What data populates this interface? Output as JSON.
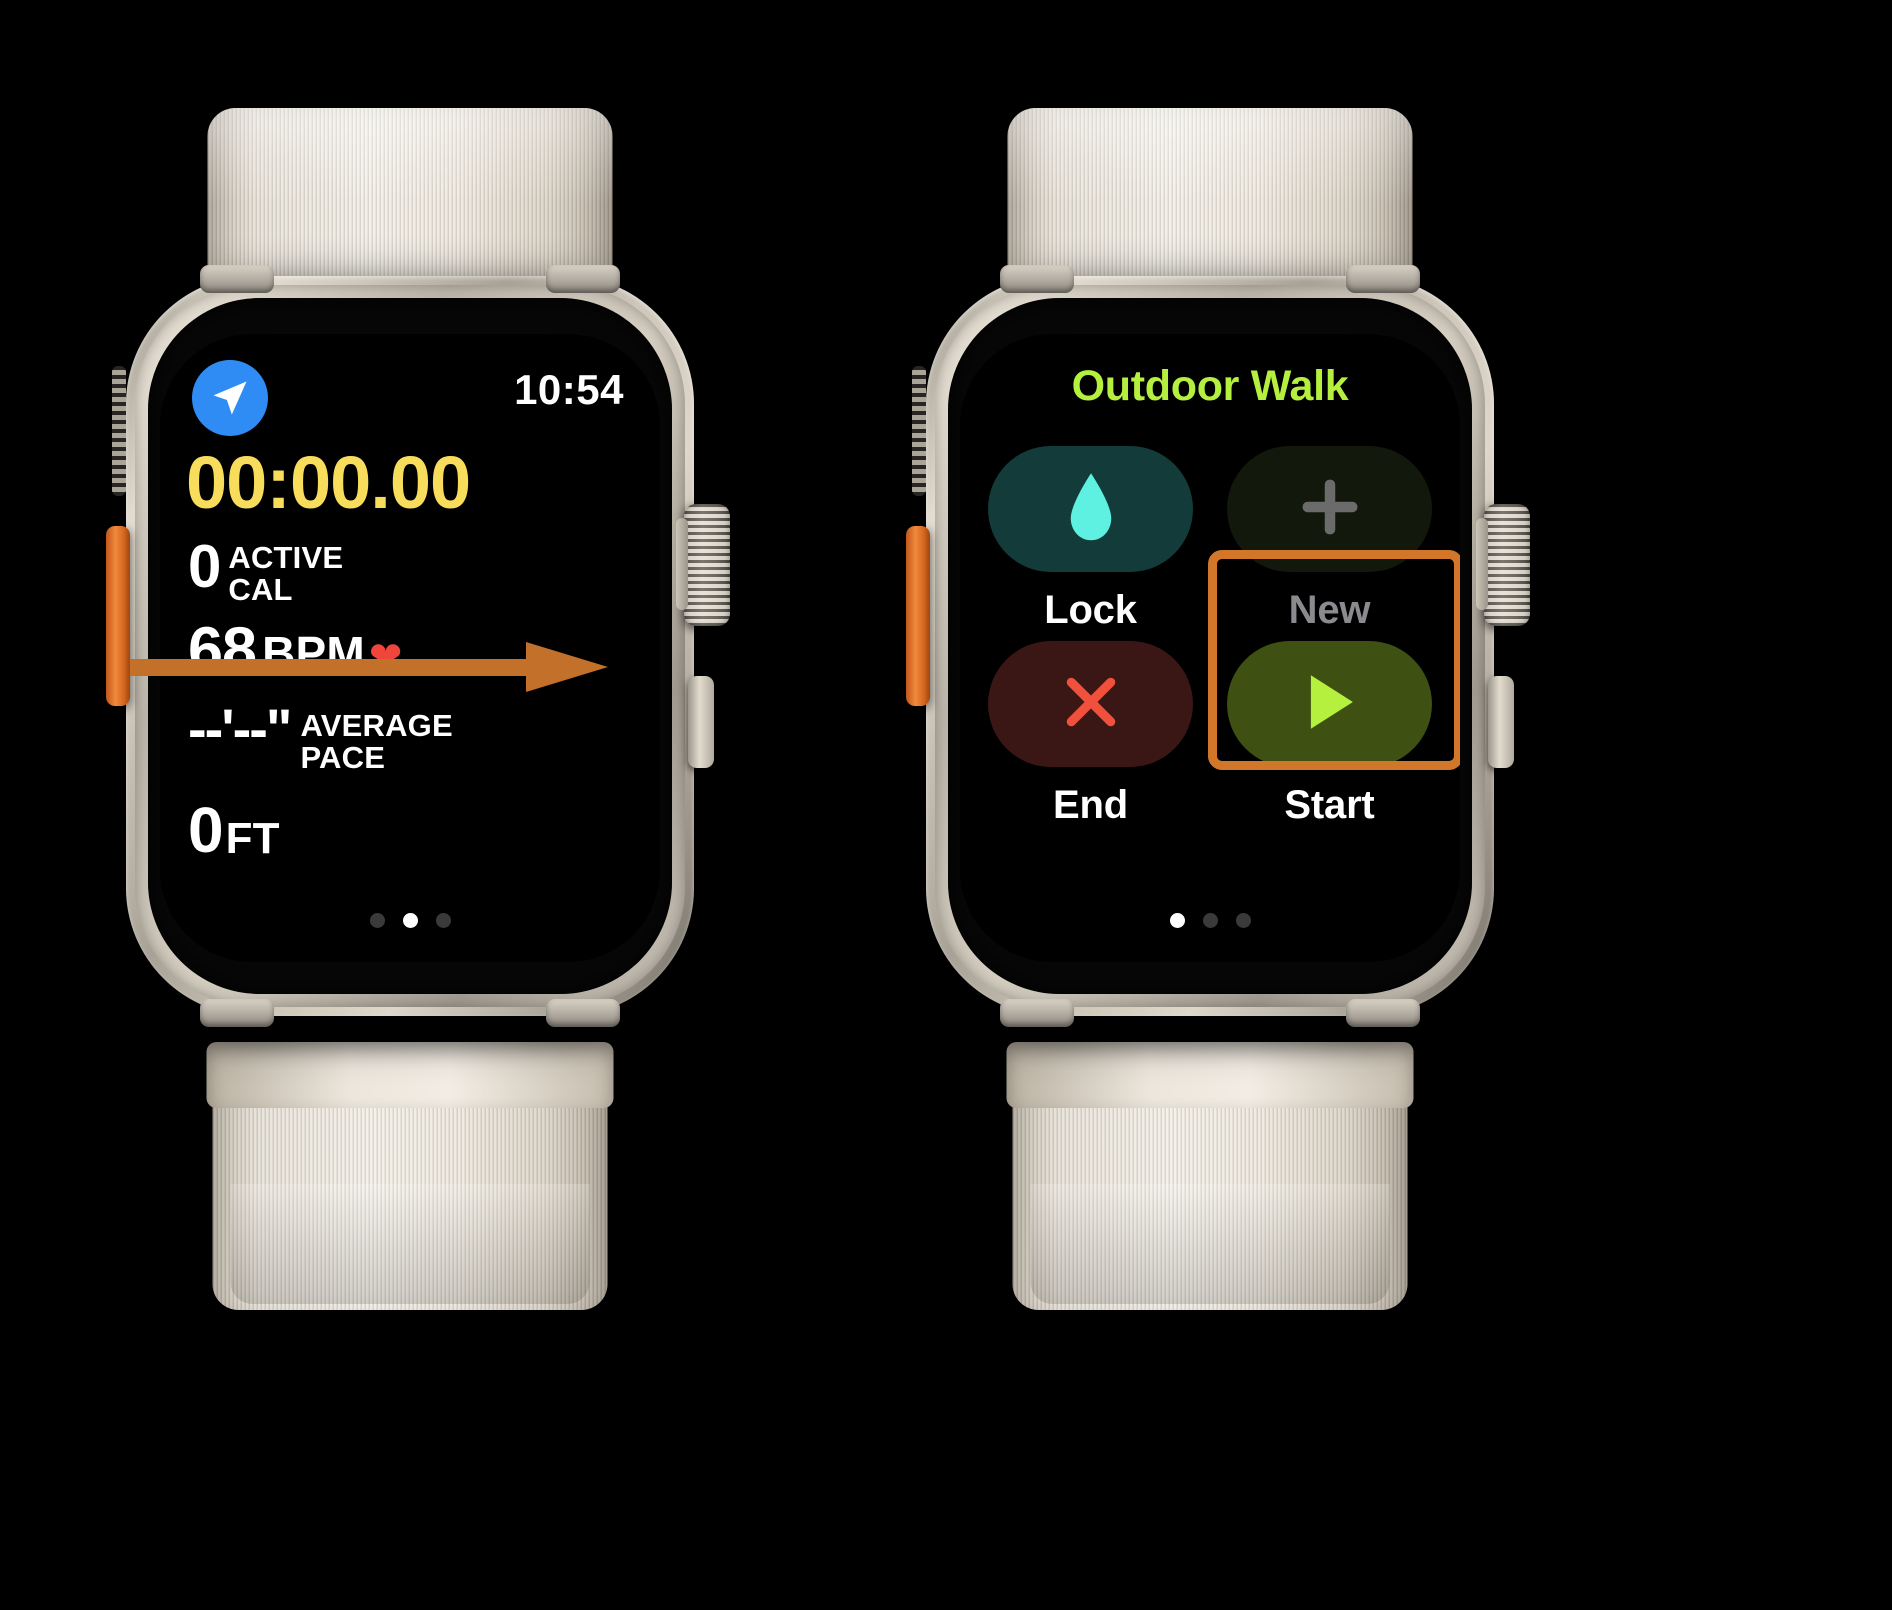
{
  "background_color": "#000000",
  "annotation": {
    "arrow_color": "#c2702a",
    "highlight_box_color": "#d2762a",
    "arrow_name": "orange-pointer-arrow",
    "highlight_name": "start-button-highlight"
  },
  "left_watch": {
    "device_name": "Apple Watch Ultra",
    "band_color": "#f0eadf",
    "case_color": "#cbc4b7",
    "action_button_color": "#e0762a",
    "screen": {
      "status": {
        "gps_icon": "location-arrow-icon",
        "gps_badge_color": "#2f8cf5",
        "time": "10:54"
      },
      "timer": {
        "value": "00:00.00",
        "color": "#f8dc5c"
      },
      "metrics": [
        {
          "value": "0",
          "unit": "ACTIVE\nCAL",
          "unit_line1": "ACTIVE",
          "unit_line2": "CAL",
          "icon": ""
        },
        {
          "value": "68",
          "unit": "BPM",
          "unit_line1": "BPM",
          "unit_line2": "",
          "icon": "heart-icon"
        },
        {
          "value": "--'--\"",
          "unit": "AVERAGE\nPACE",
          "unit_line1": "AVERAGE",
          "unit_line2": "PACE",
          "icon": ""
        },
        {
          "value": "0",
          "unit": "FT",
          "unit_line1": "FT",
          "unit_line2": "",
          "icon": ""
        }
      ],
      "heart_color": "#f0453a",
      "page_dots": {
        "count": 3,
        "active_index": 1
      }
    }
  },
  "right_watch": {
    "device_name": "Apple Watch Ultra",
    "band_color": "#f0eadf",
    "case_color": "#cbc4b7",
    "action_button_color": "#e0762a",
    "screen": {
      "title": "Outdoor Walk",
      "title_color": "#b5f03e",
      "buttons": [
        {
          "label": "Lock",
          "icon": "water-drop-icon",
          "icon_color": "#5ef0e0",
          "bg_color": "#123b39",
          "enabled": true,
          "highlighted": false
        },
        {
          "label": "New",
          "icon": "plus-icon",
          "icon_color": "#6b6b6b",
          "bg_color": "#13180c",
          "enabled": false,
          "highlighted": false
        },
        {
          "label": "End",
          "icon": "x-icon",
          "icon_color": "#f0503c",
          "bg_color": "#3a1714",
          "enabled": true,
          "highlighted": false
        },
        {
          "label": "Start",
          "icon": "play-icon",
          "icon_color": "#b5f03e",
          "bg_color": "#3e5012",
          "enabled": true,
          "highlighted": true
        }
      ],
      "page_dots": {
        "count": 3,
        "active_index": 0
      }
    }
  }
}
